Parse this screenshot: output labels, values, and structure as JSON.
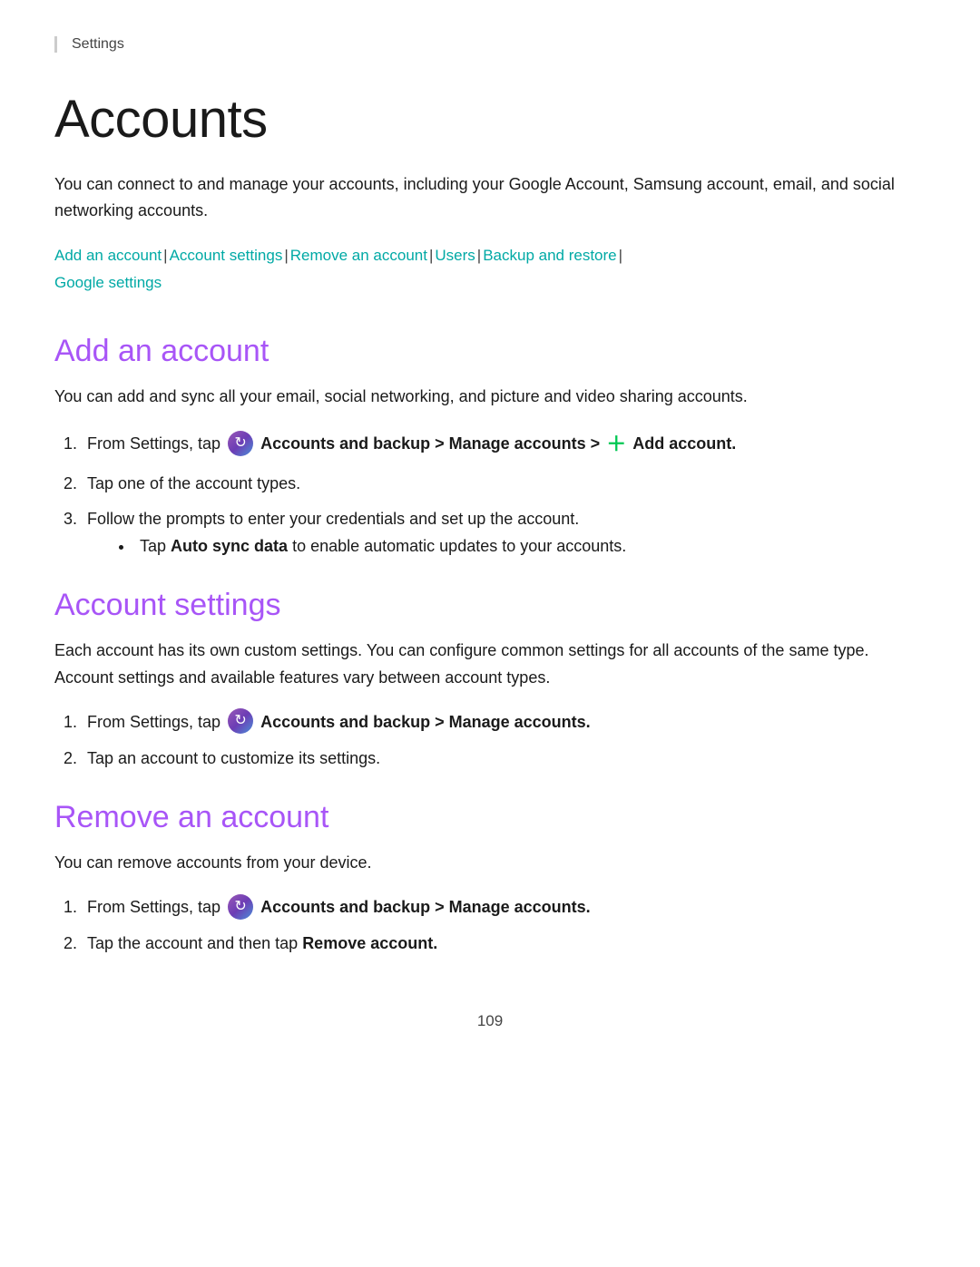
{
  "breadcrumb": {
    "label": "Settings"
  },
  "page": {
    "title": "Accounts",
    "intro": "You can connect to and manage your accounts, including your Google Account, Samsung account, email, and social networking accounts.",
    "nav_links": [
      {
        "label": "Add an account",
        "id": "add-an-account"
      },
      {
        "label": "Account settings",
        "id": "account-settings"
      },
      {
        "label": "Remove an account",
        "id": "remove-an-account"
      },
      {
        "label": "Users",
        "id": "users"
      },
      {
        "label": "Backup and restore",
        "id": "backup-and-restore"
      },
      {
        "label": "Google settings",
        "id": "google-settings"
      }
    ],
    "page_number": "109"
  },
  "sections": {
    "add_account": {
      "title": "Add an account",
      "desc": "You can add and sync all your email, social networking, and picture and video sharing accounts.",
      "steps": [
        {
          "text_before": "From Settings, tap",
          "icon": "accounts-icon",
          "bold": "Accounts and backup > Manage accounts >",
          "add_icon": true,
          "bold2": "Add account."
        },
        {
          "text": "Tap one of the account types."
        },
        {
          "text": "Follow the prompts to enter your credentials and set up the account."
        }
      ],
      "bullet": "Tap Auto sync data to enable automatic updates to your accounts.",
      "bullet_bold": "Auto sync data"
    },
    "account_settings": {
      "title": "Account settings",
      "desc": "Each account has its own custom settings. You can configure common settings for all accounts of the same type. Account settings and available features vary between account types.",
      "steps": [
        {
          "text_before": "From Settings, tap",
          "icon": "accounts-icon",
          "bold": "Accounts and backup > Manage accounts."
        },
        {
          "text": "Tap an account to customize its settings."
        }
      ]
    },
    "remove_account": {
      "title": "Remove an account",
      "desc": "You can remove accounts from your device.",
      "steps": [
        {
          "text_before": "From Settings, tap",
          "icon": "accounts-icon",
          "bold": "Accounts and backup > Manage accounts."
        },
        {
          "text_before": "Tap the account and then tap",
          "bold": "Remove account."
        }
      ]
    }
  }
}
